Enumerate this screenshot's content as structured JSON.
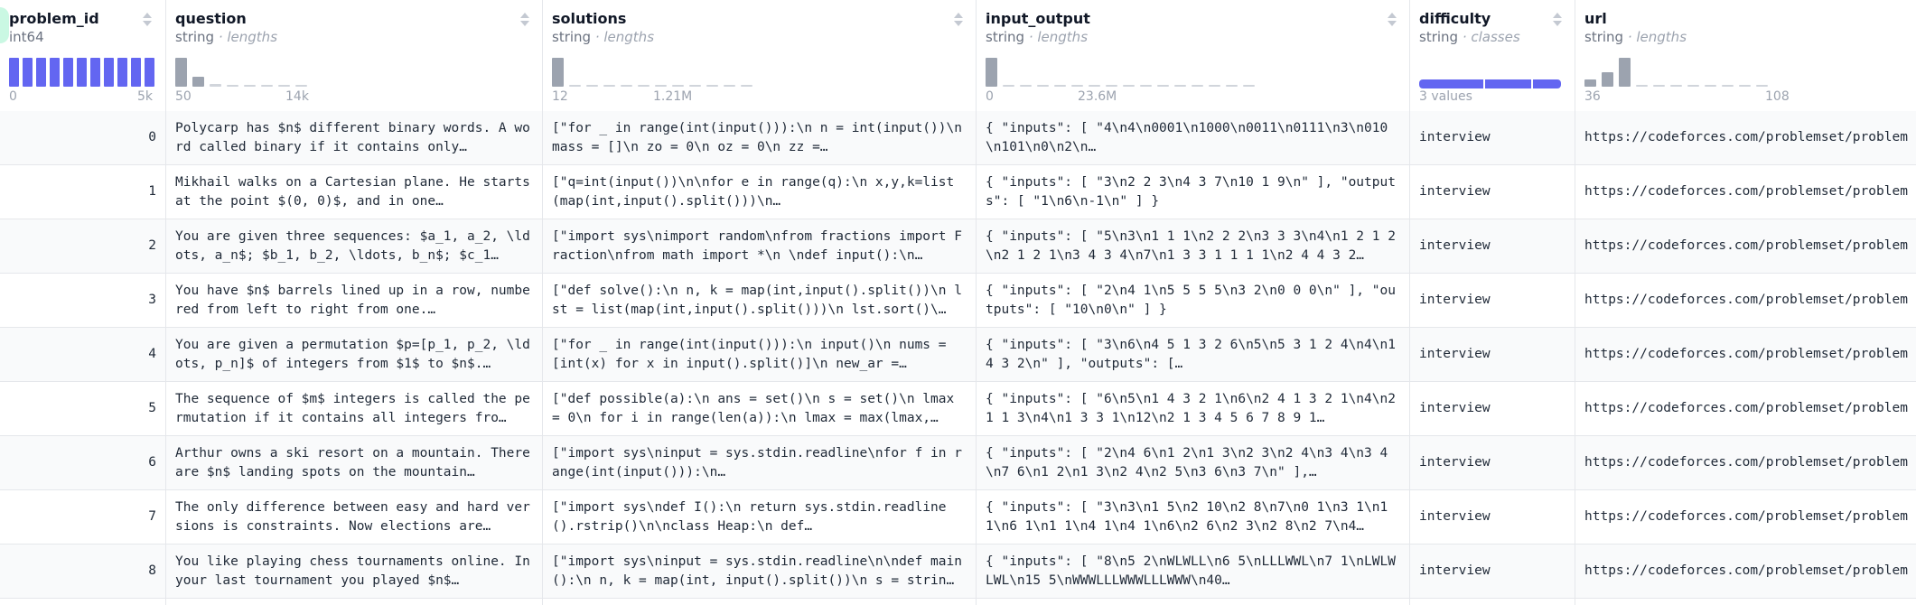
{
  "columns": [
    {
      "key": "problem_id",
      "name": "problem_id",
      "type": "int64",
      "sub": "",
      "axis_min": "0",
      "axis_max": "5k"
    },
    {
      "key": "question",
      "name": "question",
      "type": "string",
      "sub": "lengths",
      "axis_min": "50",
      "axis_max": "14k"
    },
    {
      "key": "solutions",
      "name": "solutions",
      "type": "string",
      "sub": "lengths",
      "axis_min": "12",
      "axis_max": "1.21M"
    },
    {
      "key": "input_output",
      "name": "input_output",
      "type": "string",
      "sub": "lengths",
      "axis_min": "0",
      "axis_max": "23.6M"
    },
    {
      "key": "difficulty",
      "name": "difficulty",
      "type": "string",
      "sub": "classes",
      "axis_min": "3 values",
      "axis_max": ""
    },
    {
      "key": "url",
      "name": "url",
      "type": "string",
      "sub": "lengths",
      "axis_min": "36",
      "axis_max": "108"
    }
  ],
  "separator": "·",
  "histograms": {
    "problem_id": [
      1,
      1,
      1,
      1,
      1,
      1,
      1,
      1,
      1,
      1,
      1
    ],
    "question": [
      1.0,
      0.35,
      0.08,
      0.03,
      0.03,
      0.03,
      0.02,
      0.02
    ],
    "solutions": [
      1.0,
      0.05,
      0.04,
      0.03,
      0.02,
      0.02,
      0.02,
      0.02,
      0.02,
      0.02,
      0.02,
      0.03
    ],
    "input_output": [
      1.0,
      0.05,
      0.04,
      0.03,
      0.03,
      0.02,
      0.02,
      0.02,
      0.02,
      0.02,
      0.02,
      0.02,
      0.02,
      0.02,
      0.02,
      0.02
    ],
    "url": [
      0.25,
      0.5,
      1.0,
      0.06,
      0.04,
      0.04,
      0.04,
      0.04,
      0.04,
      0.04,
      0.04
    ]
  },
  "difficulty_classes": [
    0.45,
    0.34,
    0.21
  ],
  "colors": {
    "accent": "#6366f1",
    "bar": "#9ca3af",
    "border": "#e5e7eb"
  },
  "rows": [
    {
      "problem_id": "0",
      "question": "Polycarp has $n$ different binary words. A word called binary if it contains only…",
      "solutions": "[\"for _ in range(int(input())):\\n n = int(input())\\n mass = []\\n zo = 0\\n oz = 0\\n zz =…",
      "input_output": "{ \"inputs\": [ \"4\\n4\\n0001\\n1000\\n0011\\n0111\\n3\\n010\\n101\\n0\\n2\\n…",
      "difficulty": "interview",
      "url": "https://codeforces.com/problemset/problem"
    },
    {
      "problem_id": "1",
      "question": "Mikhail walks on a Cartesian plane. He starts at the point $(0, 0)$, and in one…",
      "solutions": "[\"q=int(input())\\n\\nfor e in range(q):\\n x,y,k=list(map(int,input().split()))\\n…",
      "input_output": "{ \"inputs\": [ \"3\\n2 2 3\\n4 3 7\\n10 1 9\\n\" ], \"outputs\": [ \"1\\n6\\n-1\\n\" ] }",
      "difficulty": "interview",
      "url": "https://codeforces.com/problemset/problem"
    },
    {
      "problem_id": "2",
      "question": "You are given three sequences: $a_1, a_2, \\ldots, a_n$; $b_1, b_2, \\ldots, b_n$; $c_1…",
      "solutions": "[\"import sys\\nimport random\\nfrom fractions import Fraction\\nfrom math import *\\n \\ndef input():\\n…",
      "input_output": "{ \"inputs\": [ \"5\\n3\\n1 1 1\\n2 2 2\\n3 3 3\\n4\\n1 2 1 2\\n2 1 2 1\\n3 4 3 4\\n7\\n1 3 3 1 1 1 1\\n2 4 4 3 2…",
      "difficulty": "interview",
      "url": "https://codeforces.com/problemset/problem"
    },
    {
      "problem_id": "3",
      "question": "You have $n$ barrels lined up in a row, numbered from left to right from one.…",
      "solutions": "[\"def solve():\\n n, k = map(int,input().split())\\n lst = list(map(int,input().split()))\\n lst.sort()\\…",
      "input_output": "{ \"inputs\": [ \"2\\n4 1\\n5 5 5 5\\n3 2\\n0 0 0\\n\" ], \"outputs\": [ \"10\\n0\\n\" ] }",
      "difficulty": "interview",
      "url": "https://codeforces.com/problemset/problem"
    },
    {
      "problem_id": "4",
      "question": "You are given a permutation $p=[p_1, p_2, \\ldots, p_n]$ of integers from $1$ to $n$.…",
      "solutions": "[\"for _ in range(int(input())):\\n input()\\n nums = [int(x) for x in input().split()]\\n new_ar =…",
      "input_output": "{ \"inputs\": [ \"3\\n6\\n4 5 1 3 2 6\\n5\\n5 3 1 2 4\\n4\\n1 4 3 2\\n\" ], \"outputs\": […",
      "difficulty": "interview",
      "url": "https://codeforces.com/problemset/problem"
    },
    {
      "problem_id": "5",
      "question": "The sequence of $m$ integers is called the permutation if it contains all integers fro…",
      "solutions": "[\"def possible(a):\\n ans = set()\\n s = set()\\n lmax = 0\\n for i in range(len(a)):\\n lmax = max(lmax,…",
      "input_output": "{ \"inputs\": [ \"6\\n5\\n1 4 3 2 1\\n6\\n2 4 1 3 2 1\\n4\\n2 1 1 3\\n4\\n1 3 3 1\\n12\\n2 1 3 4 5 6 7 8 9 1…",
      "difficulty": "interview",
      "url": "https://codeforces.com/problemset/problem"
    },
    {
      "problem_id": "6",
      "question": "Arthur owns a ski resort on a mountain. There are $n$ landing spots on the mountain…",
      "solutions": "[\"import sys\\ninput = sys.stdin.readline\\nfor f in range(int(input())):\\n…",
      "input_output": "{ \"inputs\": [ \"2\\n4 6\\n1 2\\n1 3\\n2 3\\n2 4\\n3 4\\n3 4\\n7 6\\n1 2\\n1 3\\n2 4\\n2 5\\n3 6\\n3 7\\n\" ],…",
      "difficulty": "interview",
      "url": "https://codeforces.com/problemset/problem"
    },
    {
      "problem_id": "7",
      "question": "The only difference between easy and hard versions is constraints. Now elections are…",
      "solutions": "[\"import sys\\ndef I():\\n return sys.stdin.readline().rstrip()\\n\\nclass Heap:\\n def…",
      "input_output": "{ \"inputs\": [ \"3\\n3\\n1 5\\n2 10\\n2 8\\n7\\n0 1\\n3 1\\n1 1\\n6 1\\n1 1\\n4 1\\n4 1\\n6\\n2 6\\n2 3\\n2 8\\n2 7\\n4…",
      "difficulty": "interview",
      "url": "https://codeforces.com/problemset/problem"
    },
    {
      "problem_id": "8",
      "question": "You like playing chess tournaments online. In your last tournament you played $n$…",
      "solutions": "[\"import sys\\ninput = sys.stdin.readline\\n\\ndef main():\\n n, k = map(int, input().split())\\n s = strin…",
      "input_output": "{ \"inputs\": [ \"8\\n5 2\\nWLWLL\\n6 5\\nLLLWWL\\n7 1\\nLWLWLWL\\n15 5\\nWWWLLLWWWLLLWWW\\n40…",
      "difficulty": "interview",
      "url": "https://codeforces.com/problemset/problem"
    }
  ]
}
